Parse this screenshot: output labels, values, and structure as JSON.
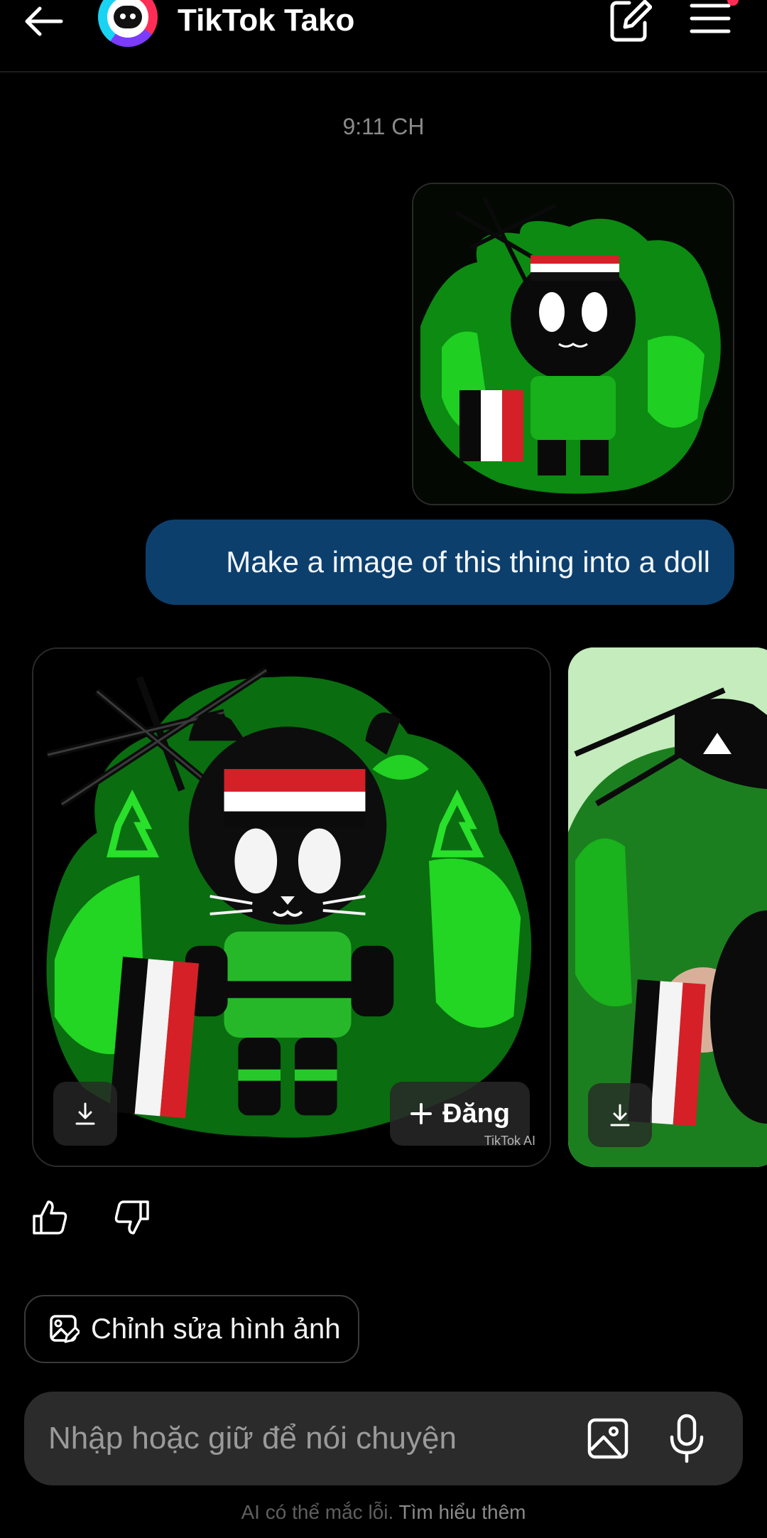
{
  "header": {
    "title": "TikTok Tako",
    "back_icon": "arrow-left-icon",
    "edit_icon": "compose-icon",
    "menu_icon": "hamburger-menu-icon",
    "notification_dot_color": "#fe2c55"
  },
  "chat": {
    "timestamp": "9:11 CH",
    "user_message": "Make a image of this thing into a doll",
    "user_bubble_color": "#0d3f6d",
    "generated": {
      "post_label": "Đăng",
      "watermark": "TikTok AI",
      "download_icon": "download-icon"
    }
  },
  "feedback": {
    "like_icon": "thumbs-up-icon",
    "dislike_icon": "thumbs-down-icon"
  },
  "edit_image": {
    "label": "Chỉnh sửa hình ảnh"
  },
  "composer": {
    "placeholder": "Nhập hoặc giữ để nói chuyện",
    "image_icon": "image-icon",
    "mic_icon": "microphone-icon"
  },
  "footer": {
    "disclaimer": "AI có thể mắc lỗi.",
    "learn_more": "Tìm hiểu thêm"
  }
}
